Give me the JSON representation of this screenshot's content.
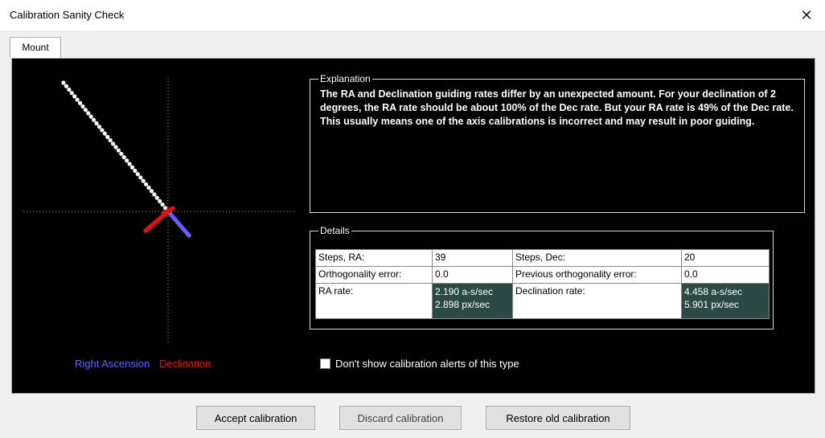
{
  "window": {
    "title": "Calibration Sanity Check",
    "close_glyph": "✕"
  },
  "tabs": [
    {
      "label": "Mount",
      "selected": true
    }
  ],
  "legend": {
    "ra_label": "Right Ascension",
    "dec_label": "Declination",
    "ra_color": "#6b5cff",
    "dec_color": "#e01010"
  },
  "explanation": {
    "title": "Explanation",
    "text": "The RA and Declination guiding rates differ by an unexpected amount.  For your declination of 2 degrees, the RA rate should be about 100% of the Dec rate.  But your RA rate is 49% of the Dec rate.  This usually means one of the axis calibrations is incorrect and may result in poor guiding."
  },
  "details": {
    "title": "Details",
    "rows": [
      [
        "Steps, RA:",
        "39",
        "Steps, Dec:",
        "20"
      ],
      [
        "Orthogonality error:",
        "0.0",
        "Previous orthogonality error:",
        "0.0"
      ],
      [
        "RA rate:",
        "2.190 a-s/sec\n2.898 px/sec",
        "Declination rate:",
        "4.458 a-s/sec\n5.901 px/sec"
      ]
    ]
  },
  "checkbox": {
    "label": "Don't show calibration alerts of this type",
    "checked": false
  },
  "buttons": {
    "accept": "Accept calibration",
    "discard": "Discard calibration",
    "restore": "Restore old calibration"
  }
}
